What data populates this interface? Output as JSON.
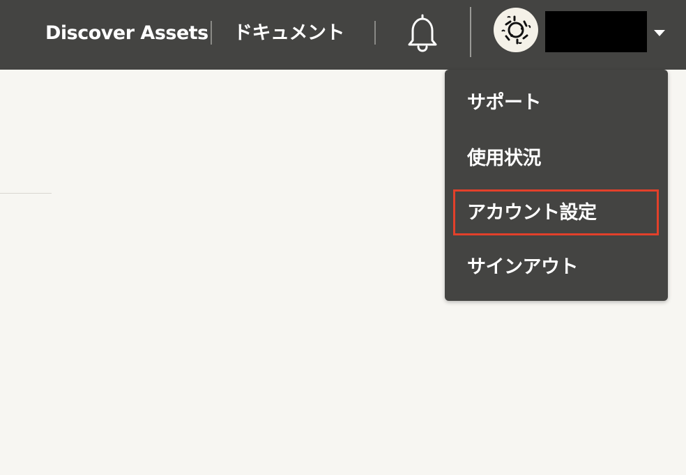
{
  "header": {
    "links": [
      {
        "label": "Discover Assets"
      },
      {
        "label": "ドキュメント"
      }
    ],
    "notifications_icon": "bell-icon",
    "avatar_icon": "avatar-icon",
    "user_name": "",
    "menu_caret_icon": "caret-down-icon"
  },
  "menu": {
    "items": [
      {
        "label": "サポート"
      },
      {
        "label": "使用状況"
      },
      {
        "label": "アカウント設定"
      },
      {
        "label": "サインアウト"
      }
    ],
    "highlighted_index": 2
  },
  "colors": {
    "topbar": "#444442",
    "background": "#f7f6f2",
    "highlight_border": "#e3402a",
    "text_light": "#ffffff"
  }
}
